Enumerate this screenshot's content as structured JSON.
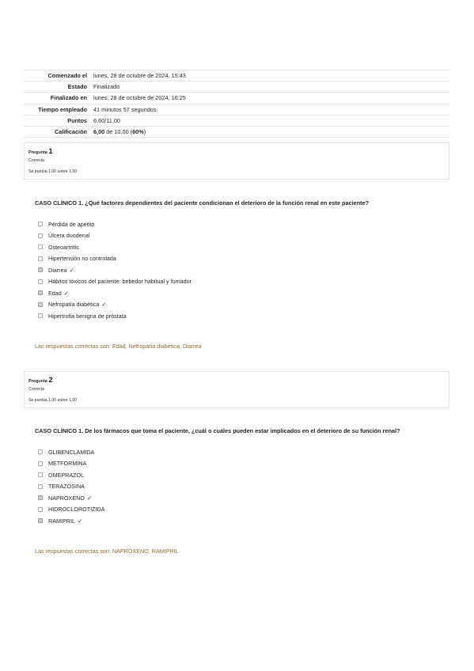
{
  "summary": [
    {
      "label": "Comenzado el",
      "value": "lunes, 28 de octubre de 2024, 15:43"
    },
    {
      "label": "Estado",
      "value": "Finalizado"
    },
    {
      "label": "Finalizado en",
      "value": "lunes, 28 de octubre de 2024, 16:25"
    },
    {
      "label": "Tiempo empleado",
      "value": "41 minutos 57 segundos"
    },
    {
      "label": "Puntos",
      "value": "6,60/11,00"
    },
    {
      "label": "Calificación",
      "score": "6,00",
      "of": "de 10,00 (",
      "pct": "60%",
      "close": ")"
    }
  ],
  "questions": [
    {
      "label": "Pregunta",
      "number": "1",
      "state": "Correcta",
      "grade": "Se puntúa 1,00 sobre 1,00",
      "text": "CASO CLÍNICO 1. ¿Qué factores dependientes del paciente condicionan el deterioro de la función renal en este paciente?",
      "answers": [
        {
          "text": "Pérdida de apetito",
          "checked": false
        },
        {
          "text": "Úlcera duodenal",
          "checked": false
        },
        {
          "text": "Osteoartritis",
          "checked": false
        },
        {
          "text": "Hipertensión no controlada",
          "checked": false
        },
        {
          "text": "Diarrea",
          "checked": true
        },
        {
          "text": "Hábitos tóxicos del paciente: bebedor habitual y fumador",
          "checked": false
        },
        {
          "text": "Edad",
          "checked": true
        },
        {
          "text": "Nefropatía diabética",
          "checked": true
        },
        {
          "text": "Hipertrofia benigna de próstata",
          "checked": false
        }
      ],
      "right_answer": "Las respuestas correctas son: Edad, Nefropatía diabética, Diarrea"
    },
    {
      "label": "Pregunta",
      "number": "2",
      "state": "Correcta",
      "grade": "Se puntúa 1,00 sobre 1,00",
      "text": "CASO CLÍNICO 1. De los fármacos que toma el paciente, ¿cuál o cuáles pueden estar implicados en el deterioro de su función renal?",
      "answers": [
        {
          "text": "GLIBENCLAMIDA",
          "checked": false
        },
        {
          "text": "METFORMINA",
          "checked": false
        },
        {
          "text": "OMEPRAZOL",
          "checked": false
        },
        {
          "text": "TERAZOSINA",
          "checked": false
        },
        {
          "text": "NAPROXENO",
          "checked": true
        },
        {
          "text": "HIDROCLOROTIZIDA",
          "checked": false
        },
        {
          "text": "RAMIPRIL",
          "checked": true
        }
      ],
      "right_answer": "Las respuestas correctas son: NAPROXENO, RAMIPRIL"
    }
  ],
  "icons": {
    "correct": "check-icon",
    "tick_glyph": "✓"
  },
  "colors": {
    "right_answer": "#8e662e",
    "border": "#dee2e6"
  }
}
